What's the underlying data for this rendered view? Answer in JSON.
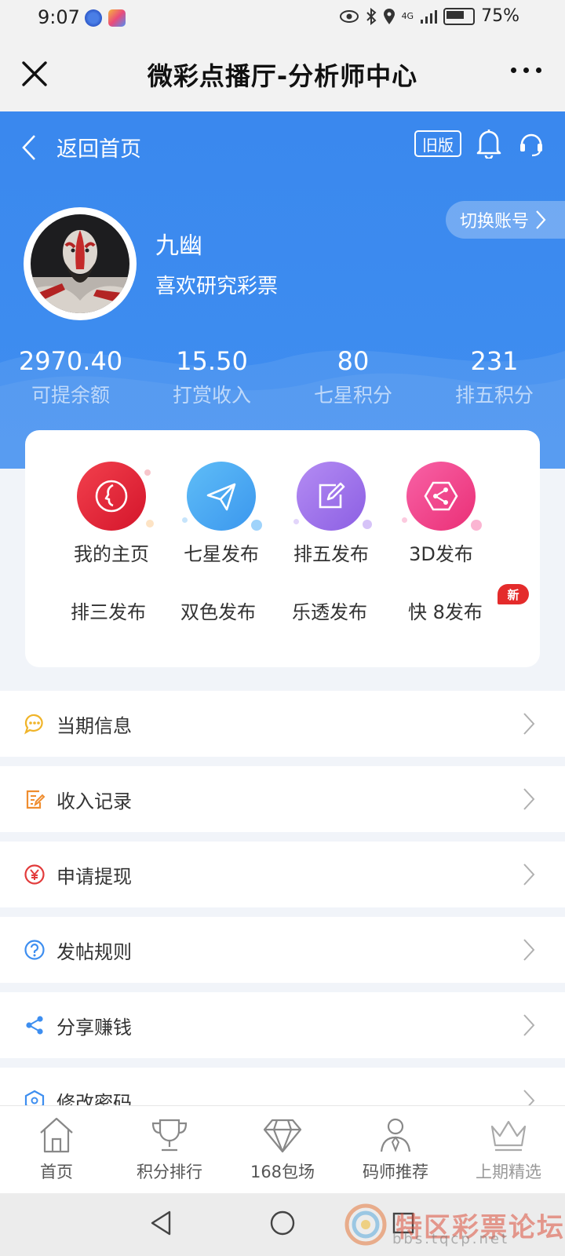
{
  "status_bar": {
    "time": "9:07",
    "network": "4G",
    "battery": "75%"
  },
  "titlebar": {
    "title": "微彩点播厅-分析师中心"
  },
  "header": {
    "back_label": "返回首页",
    "old_version_label": "旧版",
    "switch_account_label": "切换账号"
  },
  "profile": {
    "name": "九幽",
    "bio": "喜欢研究彩票"
  },
  "stats": [
    {
      "value": "2970.40",
      "label": "可提余额"
    },
    {
      "value": "15.50",
      "label": "打赏收入"
    },
    {
      "value": "80",
      "label": "七星积分"
    },
    {
      "value": "231",
      "label": "排五积分"
    }
  ],
  "features": {
    "icons": [
      {
        "label": "我的主页",
        "icon": "profile-face-icon",
        "color": "#e8263a"
      },
      {
        "label": "七星发布",
        "icon": "paper-plane-icon",
        "color": "#45a6f2"
      },
      {
        "label": "排五发布",
        "icon": "edit-icon",
        "color": "#9a72e8"
      },
      {
        "label": "3D发布",
        "icon": "share-hexagon-icon",
        "color": "#f0447d"
      }
    ],
    "text_items": [
      "排三发布",
      "双色发布",
      "乐透发布",
      "快 8发布"
    ],
    "new_badge": "新"
  },
  "menu": [
    {
      "label": "当期信息",
      "icon": "chat-bubble-icon",
      "color": "#f0b429"
    },
    {
      "label": "收入记录",
      "icon": "document-edit-icon",
      "color": "#ef8d2f"
    },
    {
      "label": "申请提现",
      "icon": "yen-icon",
      "color": "#e23b3b"
    },
    {
      "label": "发帖规则",
      "icon": "question-icon",
      "color": "#3d8ef0"
    },
    {
      "label": "分享赚钱",
      "icon": "share-icon",
      "color": "#3d8ef0"
    },
    {
      "label": "修改密码",
      "icon": "lock-hexagon-icon",
      "color": "#3d8ef0"
    }
  ],
  "tabbar": [
    {
      "label": "首页",
      "icon": "home-icon"
    },
    {
      "label": "积分排行",
      "icon": "trophy-icon"
    },
    {
      "label": "168包场",
      "icon": "diamond-icon"
    },
    {
      "label": "码师推荐",
      "icon": "person-tie-icon"
    },
    {
      "label": "上期精选",
      "icon": "crown-icon"
    }
  ],
  "watermark": {
    "text": "特区彩票论坛",
    "url": "bbs.tqcp.net"
  },
  "colors": {
    "primary": "#3f8ef0",
    "page_bg": "#f1f4f9"
  }
}
